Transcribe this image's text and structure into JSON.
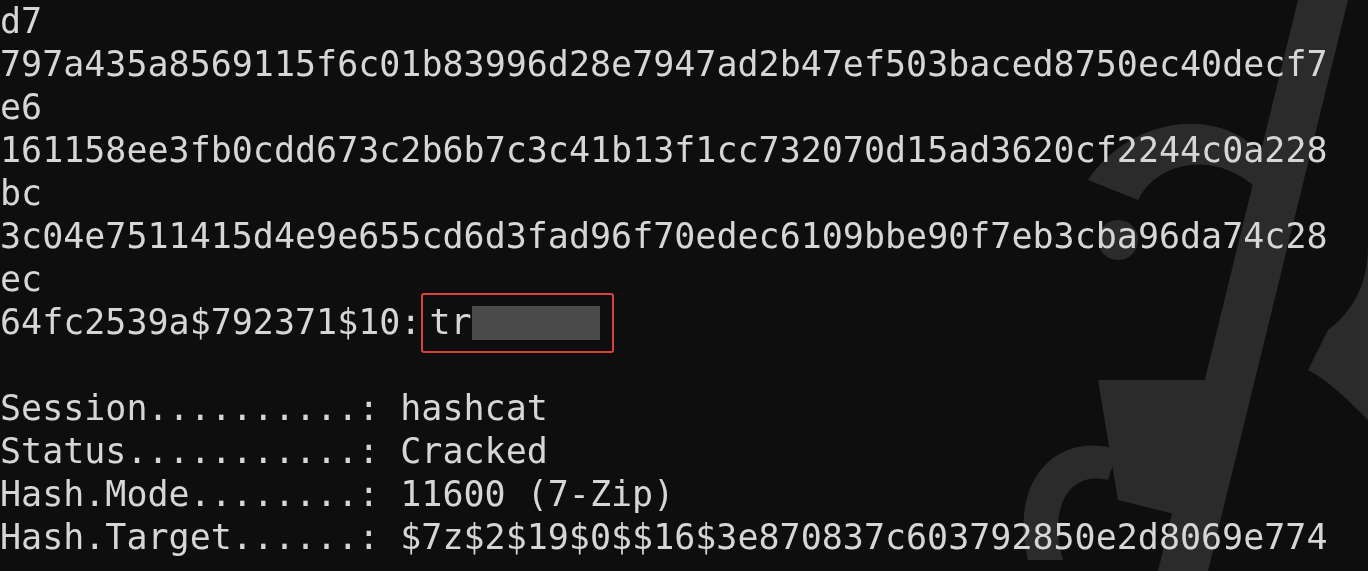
{
  "terminal": {
    "lines": [
      {
        "kind": "text",
        "text": "d7"
      },
      {
        "kind": "text",
        "text": "797a435a8569115f6c01b83996d28e7947ad2b47ef503baced8750ec40decf7"
      },
      {
        "kind": "text",
        "text": "e6"
      },
      {
        "kind": "text",
        "text": "161158ee3fb0cdd673c2b6b7c3c41b13f1cc732070d15ad3620cf2244c0a228"
      },
      {
        "kind": "text",
        "text": "bc"
      },
      {
        "kind": "text",
        "text": "3c04e7511415d4e9e655cd6d3fad96f70edec6109bbe90f7eb3cba96da74c28"
      },
      {
        "kind": "text",
        "text": "ec"
      },
      {
        "kind": "cracked",
        "text": "64fc2539a$792371$10:",
        "password": "tr"
      },
      {
        "kind": "blank"
      },
      {
        "kind": "field",
        "label": "Session..........:",
        "value": "hashcat"
      },
      {
        "kind": "field",
        "label": "Status...........:",
        "value": "Cracked"
      },
      {
        "kind": "field",
        "label": "Hash.Mode........:",
        "value": "11600 (7-Zip)"
      },
      {
        "kind": "field",
        "label": "Hash.Target......:",
        "value": "$7z$2$19$0$$16$3e870837c603792850e2d8069e774"
      }
    ]
  }
}
